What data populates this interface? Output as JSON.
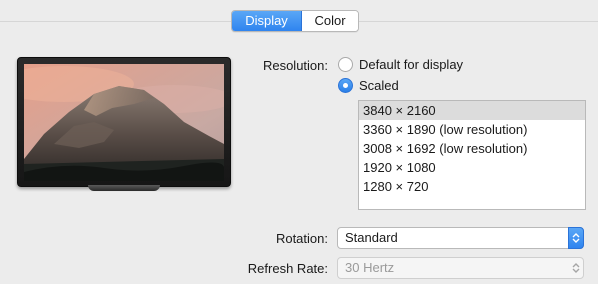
{
  "tabs": [
    {
      "label": "Display",
      "active": true
    },
    {
      "label": "Color",
      "active": false
    }
  ],
  "resolution": {
    "label": "Resolution:",
    "options": [
      {
        "label": "Default for display",
        "checked": false
      },
      {
        "label": "Scaled",
        "checked": true
      }
    ],
    "list": [
      {
        "label": "3840 × 2160",
        "selected": true
      },
      {
        "label": "3360 × 1890 (low resolution)",
        "selected": false
      },
      {
        "label": "3008 × 1692 (low resolution)",
        "selected": false
      },
      {
        "label": "1920 × 1080",
        "selected": false
      },
      {
        "label": "1280 × 720",
        "selected": false
      }
    ]
  },
  "rotation": {
    "label": "Rotation:",
    "value": "Standard"
  },
  "refresh_rate": {
    "label": "Refresh Rate:",
    "value": "30 Hertz",
    "enabled": false
  },
  "colors": {
    "accent": "#2f84ef"
  },
  "icons": {
    "monitor": "display-preview-icon",
    "stepper": "up-down-stepper-icon"
  }
}
